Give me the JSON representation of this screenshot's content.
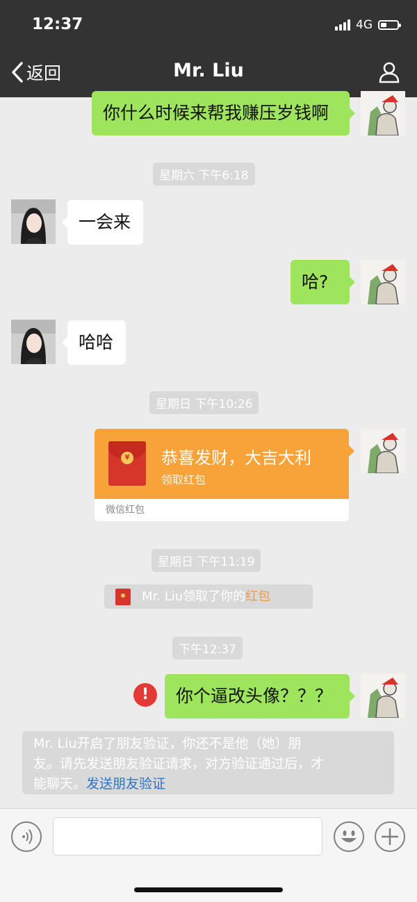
{
  "status_bar": {
    "time": "12:37",
    "network": "4G",
    "battery_level": 0.35
  },
  "nav": {
    "back_label": "返回",
    "title": "Mr. Liu",
    "profile_icon": "person-icon"
  },
  "messages": {
    "m1": "你什么时候来帮我赚压岁钱啊",
    "ts1": "星期六 下午6:18",
    "m2": "一会来",
    "m3": "哈?",
    "m4": "哈哈",
    "ts2": "星期日 下午10:26",
    "red_packet": {
      "title": "恭喜发财，大吉大利",
      "subtitle": "领取红包",
      "footer": "微信红包",
      "coin": "¥"
    },
    "ts3": "星期日 下午11:19",
    "system_note": {
      "text": "Mr. Liu领取了你的",
      "link": "红包"
    },
    "ts4": "下午12:37",
    "m5": "你个逼改头像？？？",
    "error_mark": "!",
    "verify_note": {
      "line1": "Mr. Liu开启了朋友验证，你还不是他（她）朋",
      "line2": "友。请先发送朋友验证请求，对方验证通过后，才",
      "line3": "能聊天。",
      "link": "发送朋友验证"
    }
  },
  "input_bar": {
    "voice_icon": "voice-icon",
    "emoji_icon": "emoji-icon",
    "plus_icon": "plus-icon"
  },
  "colors": {
    "nav_bg": "#333333",
    "outgoing_bubble": "#9ee45d",
    "incoming_bubble": "#ffffff",
    "red_packet": "#f8a23a",
    "link_blue": "#2d75c4",
    "error_red": "#e53935"
  }
}
